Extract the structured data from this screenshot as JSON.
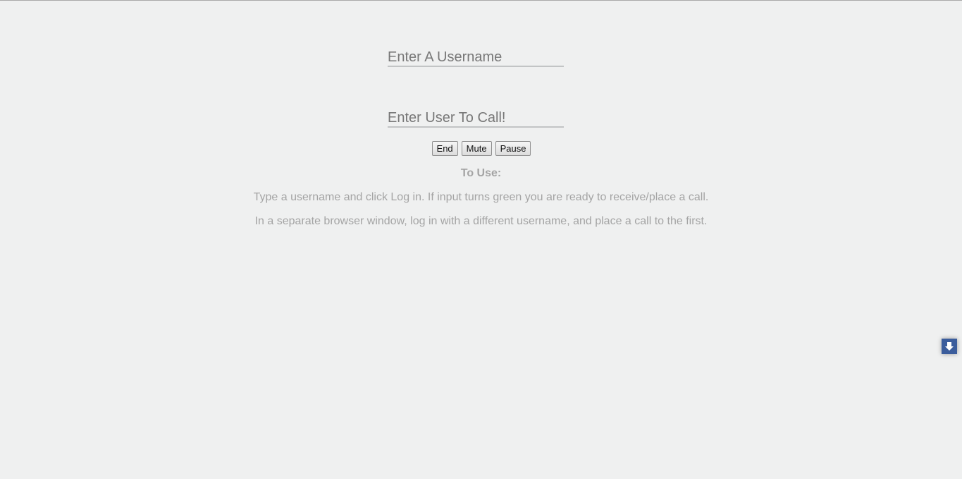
{
  "login": {
    "username_placeholder": "Enter A Username",
    "username_value": ""
  },
  "call": {
    "callee_placeholder": "Enter User To Call!",
    "callee_value": ""
  },
  "controls": {
    "end_label": "End",
    "mute_label": "Mute",
    "pause_label": "Pause"
  },
  "instructions": {
    "heading": "To Use:",
    "line1": "Type a username and click Log in. If input turns green you are ready to receive/place a call.",
    "line2": "In a separate browser window, log in with a different username, and place a call to the first."
  },
  "scroll_button": {
    "icon": "arrow-down-icon",
    "color": "#3b5d9c"
  }
}
